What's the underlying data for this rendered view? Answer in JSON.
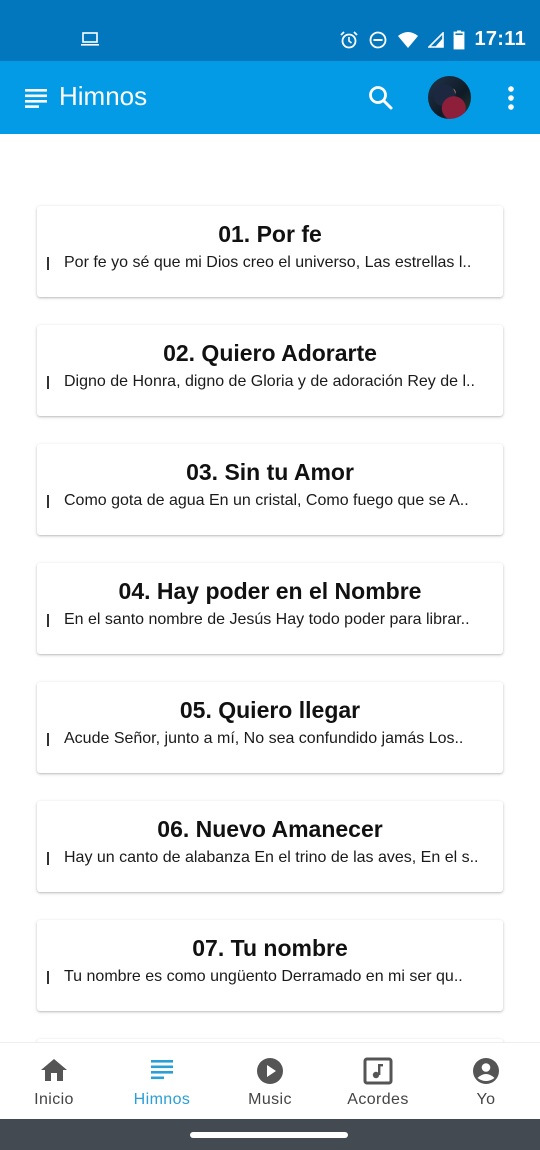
{
  "status_bar": {
    "left_icon": "laptop-icon",
    "icons": [
      "alarm-icon",
      "do-not-disturb-icon",
      "wifi-icon",
      "signal-icon",
      "battery-icon"
    ],
    "time": "17:11"
  },
  "app_bar": {
    "menu_icon": "menu-lines-icon",
    "title": "Himnos",
    "search_icon": "search-icon",
    "avatar": "user-avatar",
    "more_icon": "more-vert-icon"
  },
  "hymns": [
    {
      "title": "01. Por fe",
      "snippet": "Por fe yo sé que mi Dios creo el universo, Las estrellas l.."
    },
    {
      "title": "02. Quiero Adorarte",
      "snippet": "Digno de Honra, digno de Gloria y de adoración Rey de l.."
    },
    {
      "title": "03. Sin tu Amor",
      "snippet": "Como gota de agua En un cristal, Como fuego que se A.."
    },
    {
      "title": "04. Hay poder en el Nombre",
      "snippet": "En el santo nombre de Jesús Hay todo poder para librar.."
    },
    {
      "title": "05. Quiero llegar",
      "snippet": "Acude Señor, junto a mí, No sea confundido jamás Los.."
    },
    {
      "title": "06. Nuevo Amanecer",
      "snippet": "Hay un canto de alabanza En el trino de las aves, En el s.."
    },
    {
      "title": "07. Tu nombre",
      "snippet": " Tu nombre es como ungüento Derramado en mi ser qu.."
    }
  ],
  "bottom_nav": {
    "items": [
      {
        "label": "Inicio",
        "icon": "home-icon",
        "active": false
      },
      {
        "label": "Himnos",
        "icon": "list-icon",
        "active": true
      },
      {
        "label": "Music",
        "icon": "play-circle-icon",
        "active": false
      },
      {
        "label": "Acordes",
        "icon": "music-note-box-icon",
        "active": false
      },
      {
        "label": "Yo",
        "icon": "account-circle-icon",
        "active": false
      }
    ]
  },
  "colors": {
    "status_bar": "#0277bd",
    "app_bar": "#039be5",
    "active_nav": "#2a9fd6",
    "inactive_nav": "#555555",
    "gesture_bar": "#434a51"
  }
}
